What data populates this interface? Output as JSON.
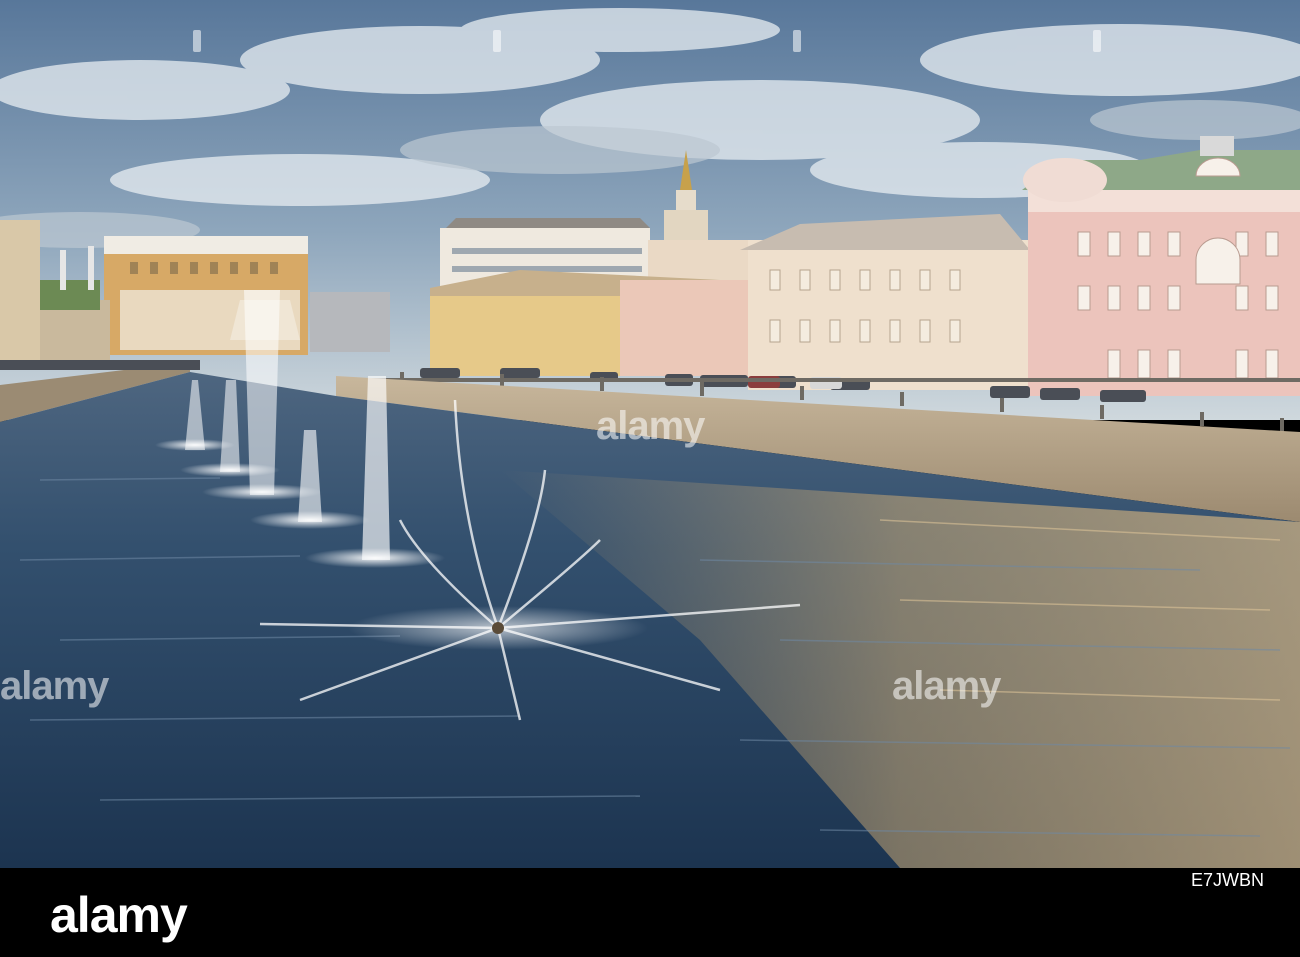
{
  "scene": {
    "subject": "Moscow river embankment with floating fountains",
    "colors": {
      "sky_top": "#5f7d9a",
      "sky_bottom": "#c9d5dc",
      "water_dark": "#20364f",
      "water_mid": "#3f5c7a",
      "water_warm": "#b89a6e",
      "embankment": "#b9a58c",
      "building_pink": "#e9c4bd",
      "building_cream": "#efe2c8",
      "roof_green": "#8fa889"
    }
  },
  "watermark": {
    "text": "alamy"
  },
  "footer": {
    "logo": "alamy",
    "image_id": "E7JWBN",
    "ref": "",
    "url": ""
  }
}
